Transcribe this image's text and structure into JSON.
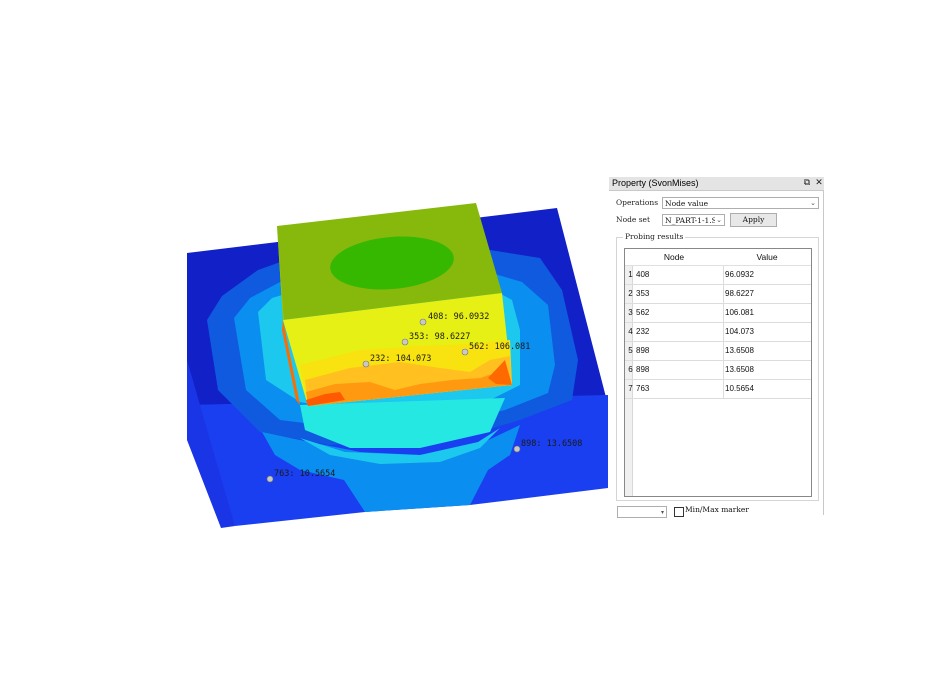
{
  "panel": {
    "title": "Property (SvonMises)",
    "float_icon": "⧉",
    "close_icon": "✕",
    "operations_label": "Operations",
    "operations_value": "Node value",
    "nodeset_label": "Node set",
    "nodeset_value": "N_PART-1-1.S",
    "apply_label": "Apply",
    "results_group_label": "Probing results",
    "columns": {
      "node": "Node",
      "value": "Value"
    },
    "rows": [
      {
        "index": "1",
        "node": "408",
        "value": "96.0932"
      },
      {
        "index": "2",
        "node": "353",
        "value": "98.6227"
      },
      {
        "index": "3",
        "node": "562",
        "value": "106.081"
      },
      {
        "index": "4",
        "node": "232",
        "value": "104.073"
      },
      {
        "index": "5",
        "node": "898",
        "value": "13.6508"
      },
      {
        "index": "6",
        "node": "898",
        "value": "13.6508"
      },
      {
        "index": "7",
        "node": "763",
        "value": "10.5654"
      }
    ],
    "bottom_combo_value": "",
    "minmax_label": "Min/Max marker",
    "minmax_checked": false
  },
  "probes": [
    {
      "label": "408: 96.0932"
    },
    {
      "label": "353: 98.6227"
    },
    {
      "label": "562: 106.081"
    },
    {
      "label": "232: 104.073"
    },
    {
      "label": "898: 13.6508"
    },
    {
      "label": "763: 10.5654"
    }
  ],
  "colors": {
    "contour_dark_blue": "#0f1fd0",
    "contour_blue": "#1e4fe6",
    "contour_light_blue": "#0a8ef0",
    "contour_cyan": "#1cc8ee",
    "contour_aqua": "#2ee6e0",
    "contour_green": "#38c200",
    "contour_olive": "#8ab80a",
    "contour_yellow": "#e8ee10",
    "contour_orange": "#ff8a10",
    "contour_red": "#ff4a00"
  }
}
